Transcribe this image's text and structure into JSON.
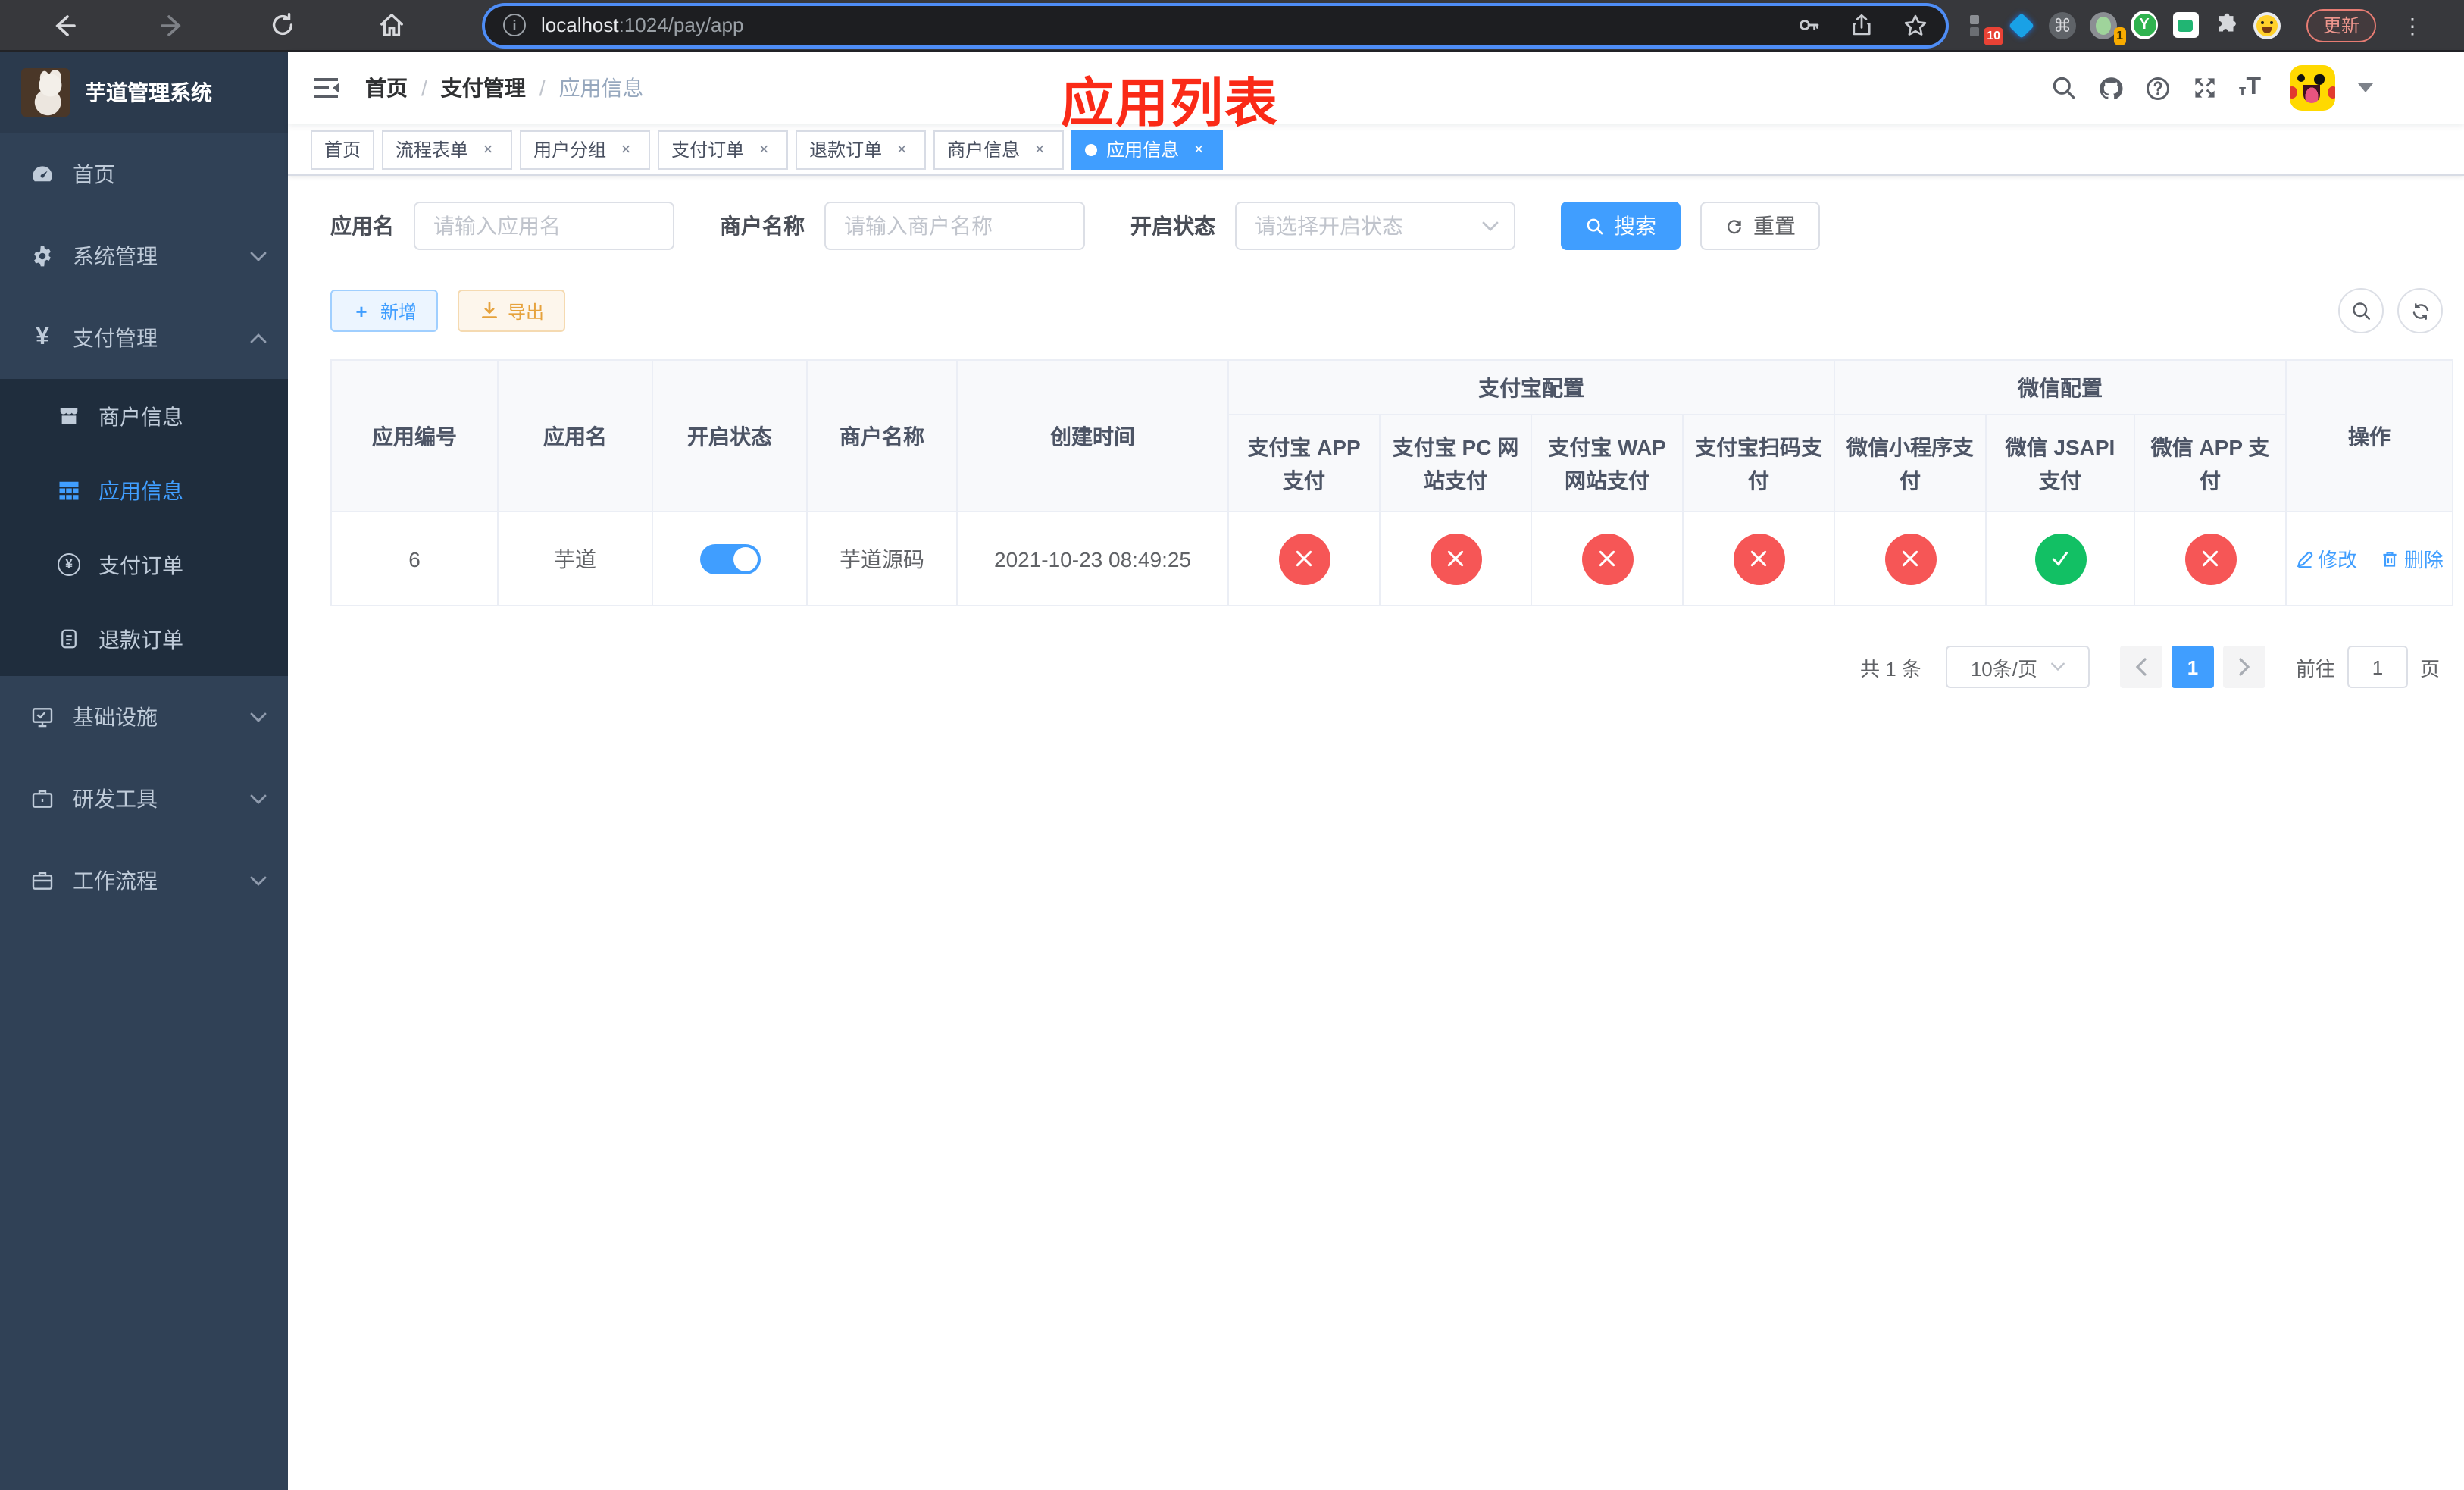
{
  "browser": {
    "url": {
      "host": "localhost",
      "path": ":1024/pay/app"
    },
    "badges": {
      "ten": "10",
      "one": "1"
    },
    "extension_y": "Y",
    "update_label": "更新"
  },
  "sidebar": {
    "title": "芋道管理系统",
    "menu": {
      "home": {
        "label": "首页"
      },
      "system": {
        "label": "系统管理"
      },
      "pay": {
        "label": "支付管理"
      },
      "merchant": {
        "label": "商户信息"
      },
      "app": {
        "label": "应用信息"
      },
      "pay_order": {
        "label": "支付订单"
      },
      "refund_order": {
        "label": "退款订单"
      },
      "infra": {
        "label": "基础设施"
      },
      "devtools": {
        "label": "研发工具"
      },
      "workflow": {
        "label": "工作流程"
      }
    }
  },
  "header": {
    "breadcrumb": [
      "首页",
      "支付管理",
      "应用信息"
    ],
    "annotation": "应用列表"
  },
  "tabs": {
    "items": [
      {
        "label": "首页"
      },
      {
        "label": "流程表单"
      },
      {
        "label": "用户分组"
      },
      {
        "label": "支付订单"
      },
      {
        "label": "退款订单"
      },
      {
        "label": "商户信息"
      },
      {
        "label": "应用信息"
      }
    ]
  },
  "filters": {
    "app_name_label": "应用名",
    "app_name_placeholder": "请输入应用名",
    "merchant_label": "商户名称",
    "merchant_placeholder": "请输入商户名称",
    "status_label": "开启状态",
    "status_placeholder": "请选择开启状态",
    "search_label": "搜索",
    "reset_label": "重置"
  },
  "toolbar": {
    "add_label": "新增",
    "export_label": "导出"
  },
  "table": {
    "groups": {
      "alipay": "支付宝配置",
      "wechat": "微信配置"
    },
    "columns": [
      "应用编号",
      "应用名",
      "开启状态",
      "商户名称",
      "创建时间",
      "支付宝 APP 支付",
      "支付宝 PC 网站支付",
      "支付宝 WAP 网站支付",
      "支付宝扫码支付",
      "微信小程序支付",
      "微信 JSAPI 支付",
      "微信 APP 支付",
      "操作"
    ],
    "rows": [
      {
        "id": "6",
        "name": "芋道",
        "enabled": true,
        "merchant": "芋道源码",
        "created_at": "2021-10-23 08:49:25",
        "channels": [
          "no",
          "no",
          "no",
          "no",
          "no",
          "yes",
          "no"
        ],
        "edit_label": "修改",
        "delete_label": "删除"
      }
    ]
  },
  "pagination": {
    "total": "共 1 条",
    "page_size": "10条/页",
    "current_page": "1",
    "goto_label": "前往",
    "goto_value": "1",
    "page_unit": "页"
  },
  "colors": {
    "accent": "#409eff",
    "danger": "#f65656",
    "success": "#12c064",
    "annotation_red": "#fa2a17",
    "sidebar_bg": "#304156",
    "submenu_bg": "#1f2d3d"
  }
}
